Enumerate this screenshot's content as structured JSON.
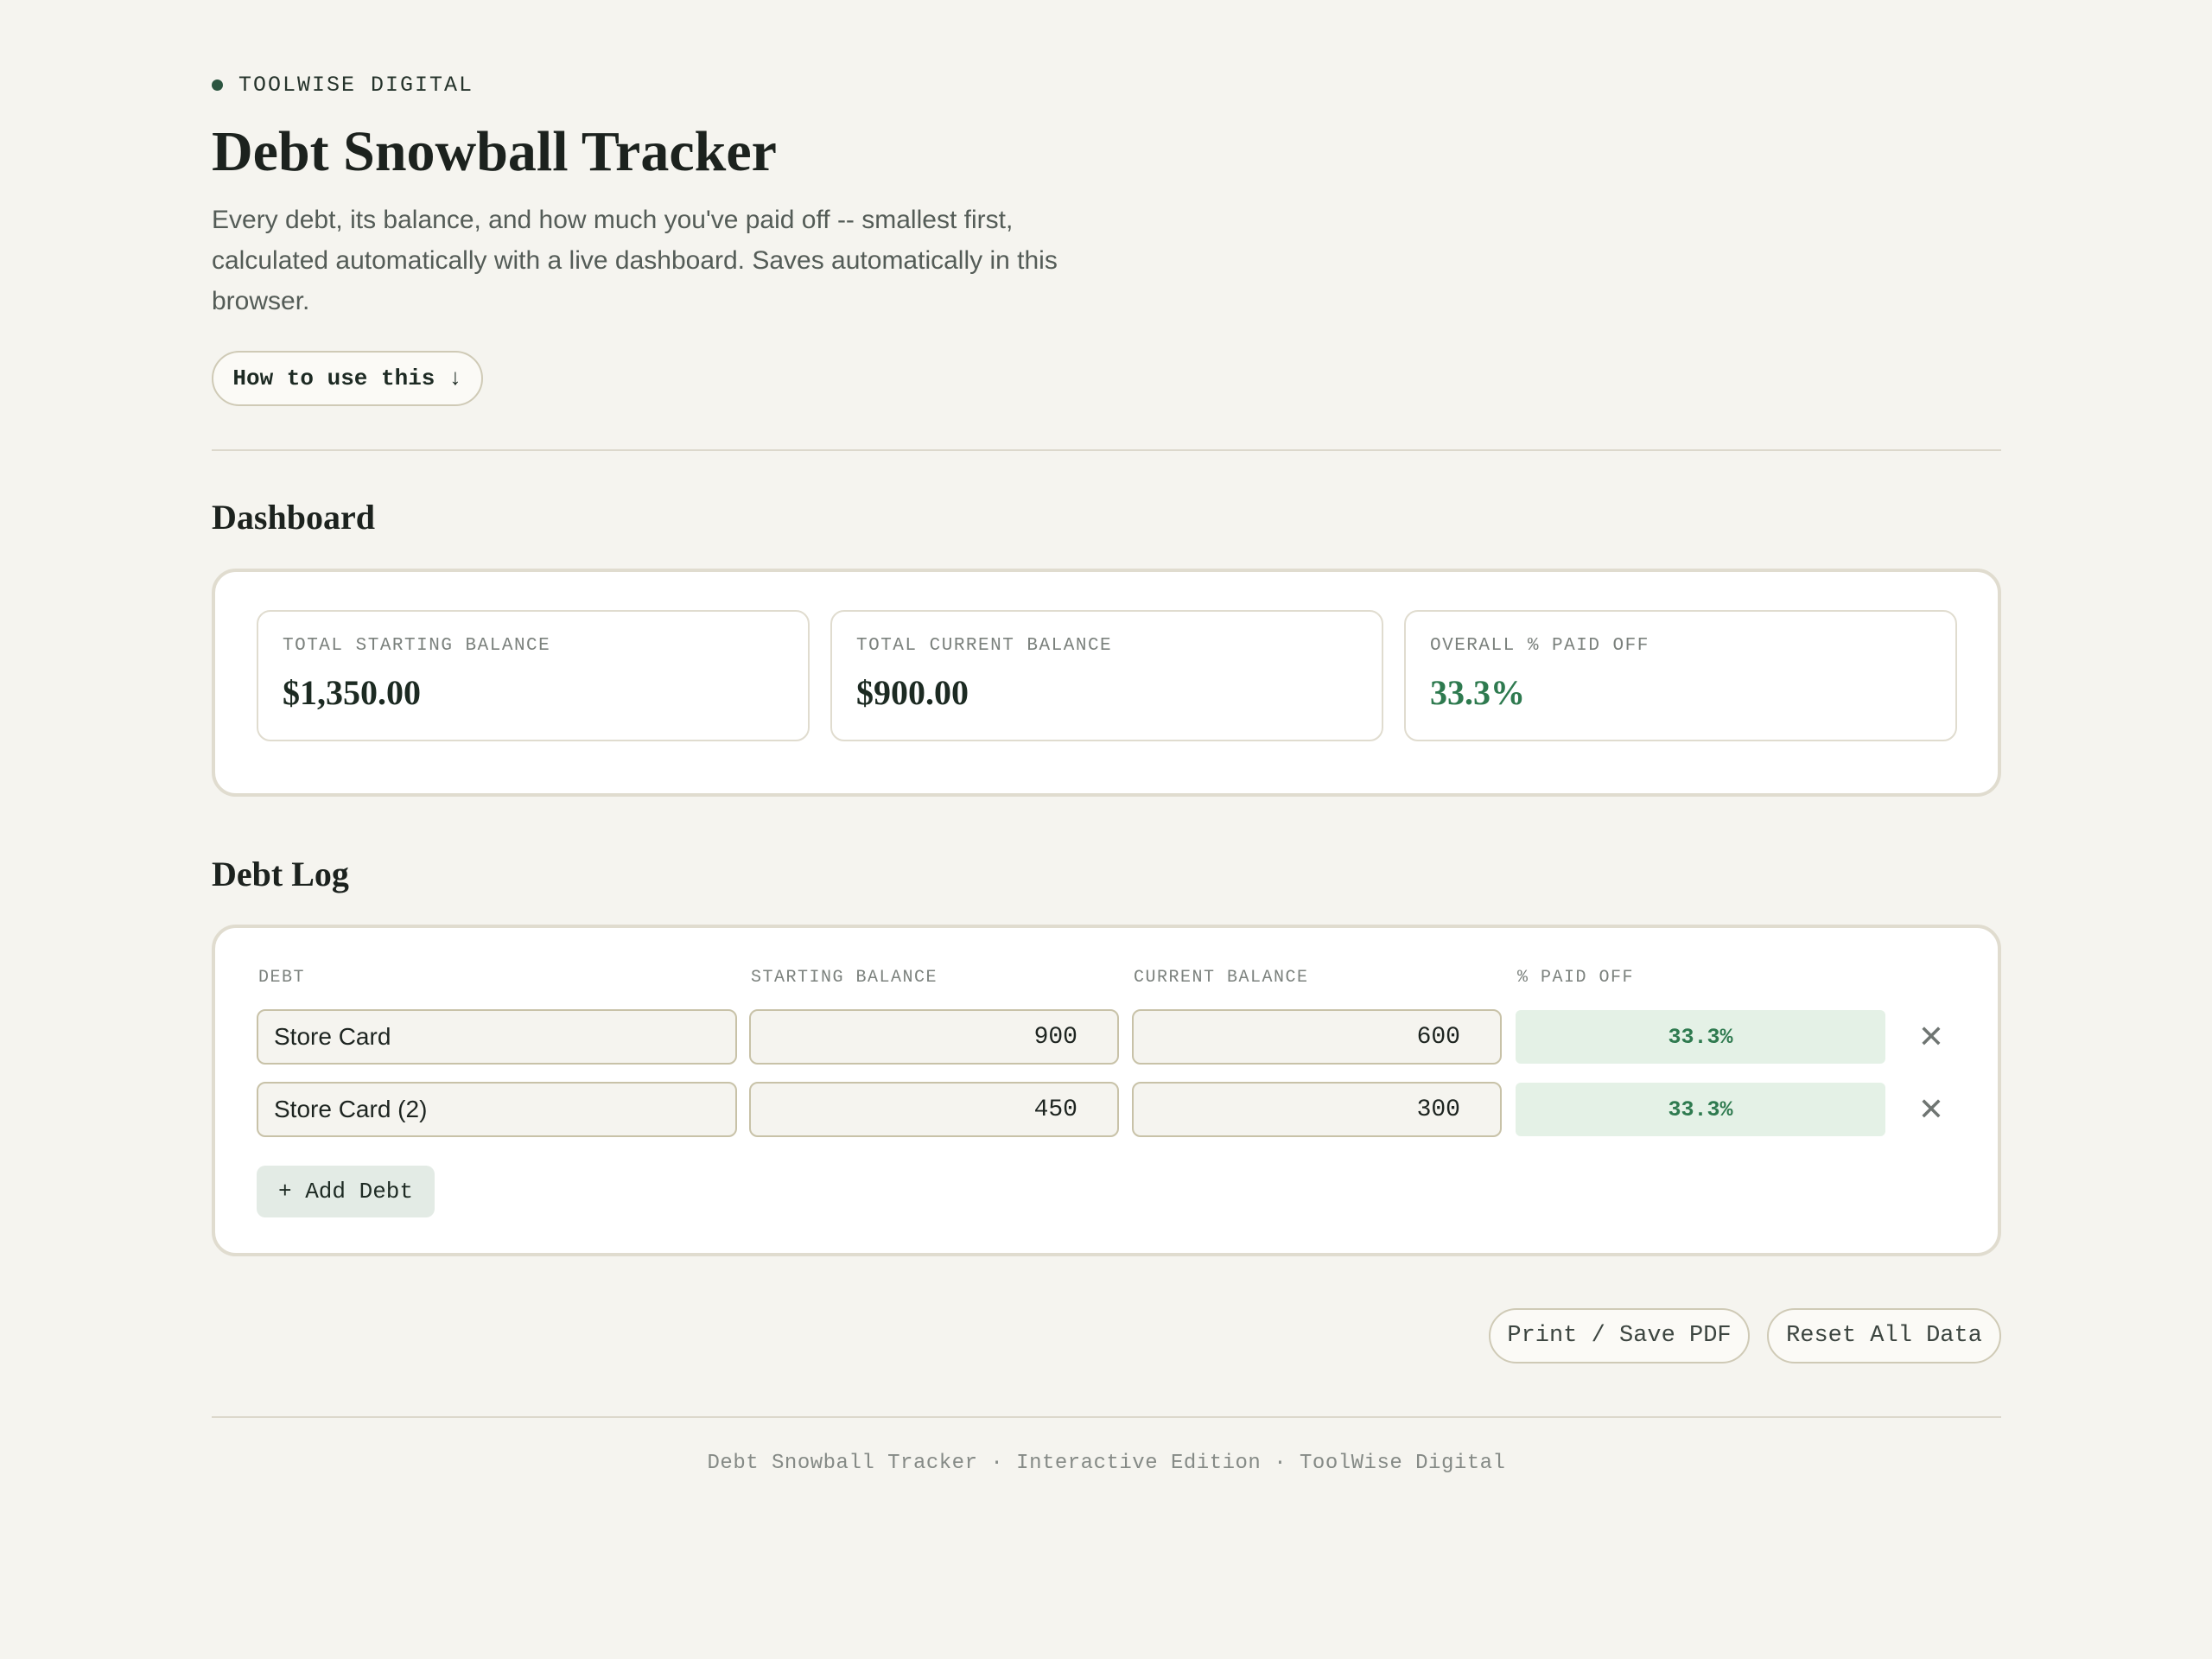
{
  "header": {
    "brand": "TOOLWISE DIGITAL",
    "title": "Debt Snowball Tracker",
    "subtitle": "Every debt, its balance, and how much you've paid off -- smallest first, calculated automatically with a live dashboard. Saves automatically in this browser.",
    "how_to_label": "How to use this ↓"
  },
  "dashboard": {
    "heading": "Dashboard",
    "stats": [
      {
        "label": "TOTAL STARTING BALANCE",
        "value": "$1,350.00"
      },
      {
        "label": "TOTAL CURRENT BALANCE",
        "value": "$900.00"
      },
      {
        "label": "OVERALL % PAID OFF",
        "value": "33.3%"
      }
    ]
  },
  "debt_log": {
    "heading": "Debt Log",
    "columns": [
      "DEBT",
      "STARTING BALANCE",
      "CURRENT BALANCE",
      "% PAID OFF"
    ],
    "rows": [
      {
        "name": "Store Card",
        "starting": "900",
        "current": "600",
        "paid_pct": "33.3%"
      },
      {
        "name": "Store Card (2)",
        "starting": "450",
        "current": "300",
        "paid_pct": "33.3%"
      }
    ],
    "remove_glyph": "✕",
    "add_label": "+ Add Debt"
  },
  "actions": {
    "print_label": "Print / Save PDF",
    "reset_label": "Reset All Data"
  },
  "footer": {
    "text": "Debt Snowball Tracker · Interactive Edition · ToolWise Digital"
  },
  "colors": {
    "background": "#f5f4ef",
    "accent_green": "#2e7a4f",
    "paid_bg": "#e4f1e6"
  }
}
